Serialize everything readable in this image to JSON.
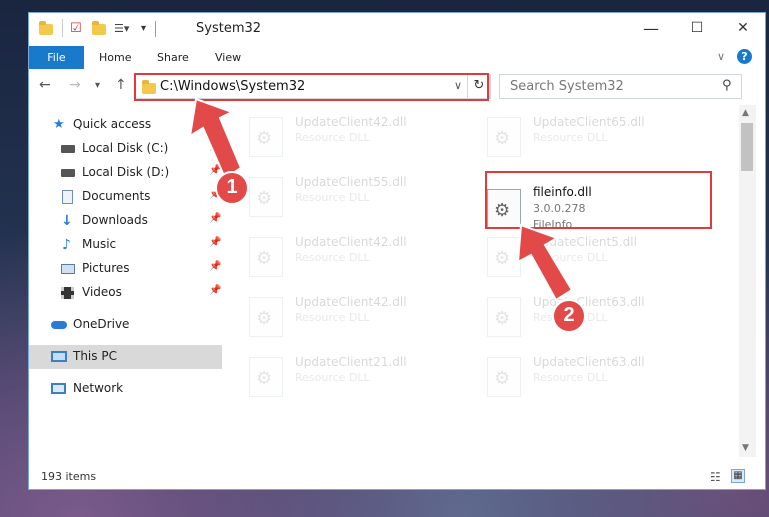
{
  "window": {
    "title": "System32",
    "controls": {
      "minimize": "—",
      "maximize": "☐",
      "close": "✕"
    }
  },
  "ribbon": {
    "file": "File",
    "tabs": [
      "Home",
      "Share",
      "View"
    ]
  },
  "address": {
    "path": "C:\\Windows\\System32",
    "search_placeholder": "Search System32"
  },
  "sidebar": [
    {
      "label": "Quick access",
      "icon": "star-icon"
    },
    {
      "label": "Local Disk (C:)",
      "icon": "drive-icon"
    },
    {
      "label": "Local Disk (D:)",
      "icon": "drive-icon"
    },
    {
      "label": "Documents",
      "icon": "documents-icon"
    },
    {
      "label": "Downloads",
      "icon": "download-icon"
    },
    {
      "label": "Music",
      "icon": "music-icon"
    },
    {
      "label": "Pictures",
      "icon": "pictures-icon"
    },
    {
      "label": "Videos",
      "icon": "videos-icon"
    },
    {
      "label": "OneDrive",
      "icon": "cloud-icon"
    },
    {
      "label": "This PC",
      "icon": "pc-icon"
    },
    {
      "label": "Network",
      "icon": "network-icon"
    }
  ],
  "files_left": [
    {
      "name": "UpdateClient42.dll",
      "desc": "Resource DLL"
    },
    {
      "name": "UpdateClient55.dll",
      "desc": "Resource DLL"
    },
    {
      "name": "UpdateClient42.dll",
      "desc": "Resource DLL"
    },
    {
      "name": "UpdateClient42.dll",
      "desc": "Resource DLL"
    },
    {
      "name": "UpdateClient21.dll",
      "desc": "Resource DLL"
    }
  ],
  "files_right": [
    {
      "name": "UpdateClient65.dll",
      "desc": "Resource DLL"
    },
    {
      "name": "fileinfo.dll",
      "version": "3.0.0.278",
      "desc": "FileInfo"
    },
    {
      "name": "UpdateClient5.dll",
      "desc": "Resource DLL"
    },
    {
      "name": "UpdateClient63.dll",
      "desc": "Resource DLL"
    },
    {
      "name": "UpdateClient63.dll",
      "desc": "Resource DLL"
    }
  ],
  "status": {
    "count": "193 items"
  },
  "callouts": [
    "1",
    "2"
  ],
  "colors": {
    "accent": "#1979ca",
    "highlight": "#e03a3a",
    "callout": "#e24a4a"
  }
}
